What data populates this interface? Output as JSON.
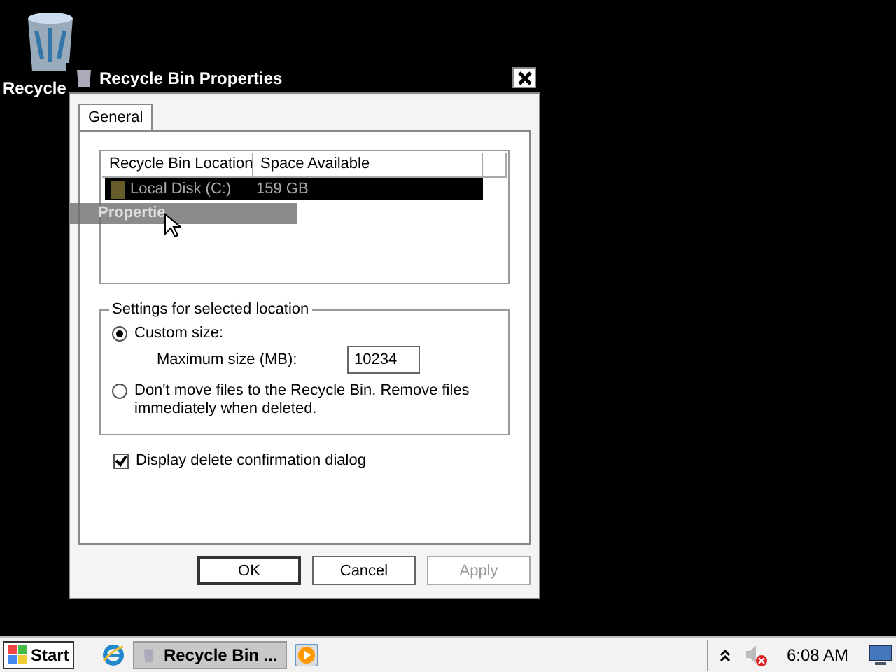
{
  "desktop_icons": [
    {
      "label": "Recycle"
    }
  ],
  "window": {
    "title": "Recycle Bin Properties"
  },
  "tabs": [
    {
      "label": "General",
      "selected": true
    }
  ],
  "locations": {
    "columns": [
      "Recycle Bin Location",
      "Space Available"
    ],
    "rows": [
      {
        "location": "Local Disk (C:)",
        "space": "159 GB",
        "selected": true
      }
    ]
  },
  "drag_label": "Propertie",
  "settings": {
    "title": "Settings for selected location",
    "options": [
      {
        "label": "Custom size:",
        "selected": true
      },
      {
        "label": "Don't move files to the Recycle Bin. Remove files immediately when deleted.",
        "selected": false
      }
    ],
    "max_size_label": "Maximum size (MB):",
    "max_size_value": "10234"
  },
  "confirm": {
    "label": "Display delete confirmation dialog",
    "checked": true
  },
  "buttons": [
    {
      "label": "OK",
      "disabled": false
    },
    {
      "label": "Cancel",
      "disabled": false
    },
    {
      "label": "Apply",
      "disabled": true
    }
  ],
  "taskbar": {
    "start": "Start",
    "tasks": [
      {
        "label": "Recycle Bin ...",
        "selected": true
      }
    ],
    "clock": "6:08 AM"
  }
}
